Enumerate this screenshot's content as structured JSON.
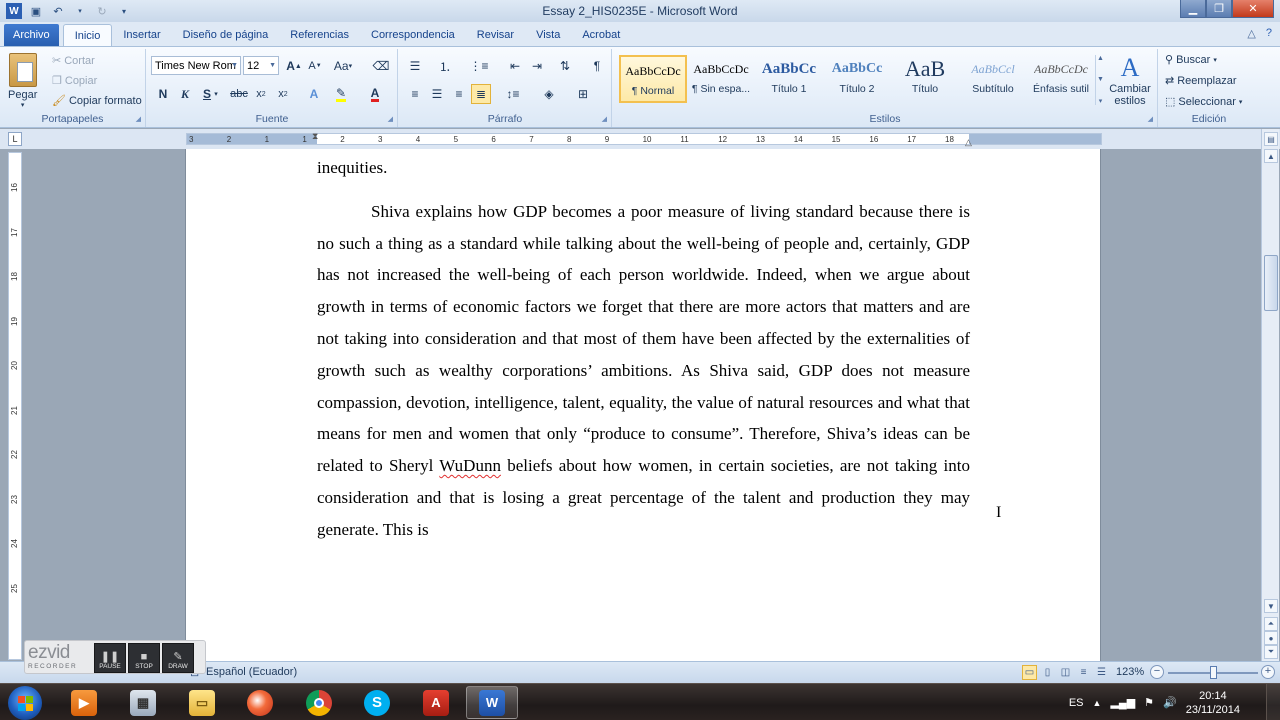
{
  "window": {
    "title": "Essay 2_HIS0235E  -  Microsoft Word"
  },
  "tabs": [
    {
      "label": "Archivo"
    },
    {
      "label": "Inicio"
    },
    {
      "label": "Insertar"
    },
    {
      "label": "Diseño de página"
    },
    {
      "label": "Referencias"
    },
    {
      "label": "Correspondencia"
    },
    {
      "label": "Revisar"
    },
    {
      "label": "Vista"
    },
    {
      "label": "Acrobat"
    }
  ],
  "ribbon": {
    "clipboard": {
      "label": "Portapapeles",
      "paste": "Pegar",
      "cut": "Cortar",
      "copy": "Copiar",
      "format_painter": "Copiar formato"
    },
    "font": {
      "label": "Fuente",
      "font_name": "Times New Rom",
      "font_size": "12",
      "bold": "N",
      "italic": "K",
      "underline": "S"
    },
    "paragraph": {
      "label": "Párrafo"
    },
    "styles": {
      "label": "Estilos",
      "items": [
        {
          "sample": "AaBbCcDc",
          "name": "¶ Normal"
        },
        {
          "sample": "AaBbCcDc",
          "name": "¶ Sin espa..."
        },
        {
          "sample": "AaBbCc",
          "name": "Título 1"
        },
        {
          "sample": "AaBbCc",
          "name": "Título 2"
        },
        {
          "sample": "AaB",
          "name": "Título"
        },
        {
          "sample": "AaBbCcl",
          "name": "Subtítulo"
        },
        {
          "sample": "AaBbCcDc",
          "name": "Énfasis sutil"
        }
      ],
      "change_styles": "Cambiar estilos"
    },
    "editing": {
      "label": "Edición",
      "find": "Buscar",
      "replace": "Reemplazar",
      "select": "Seleccionar"
    }
  },
  "ruler": {
    "h_ticks": [
      "3",
      "2",
      "1",
      "1",
      "2",
      "3",
      "4",
      "5",
      "6",
      "7",
      "8",
      "9",
      "10",
      "11",
      "12",
      "13",
      "14",
      "15",
      "16",
      "17",
      "18"
    ],
    "v_ticks": [
      "16",
      "17",
      "18",
      "19",
      "20",
      "21",
      "22",
      "23",
      "24",
      "25"
    ]
  },
  "document": {
    "line0": "inequities.",
    "para_before": "Shiva explains how GDP becomes a poor measure of living standard because there is no such a thing as a standard while talking about the well-being of people and, certainly, GDP has not increased the well-being of each person worldwide. Indeed, when we argue about growth in terms of economic factors we forget that there are more actors that matters and are not taking into consideration and that most of them have been affected by the externalities of growth such as wealthy corporations’ ambitions. As Shiva said, GDP does not measure compassion, devotion, intelligence, talent, equality, the value of natural resources and what that means for men and women that only “produce to consume”. Therefore, Shiva’s ideas can be related to Sheryl ",
    "misspelled": "WuDunn",
    "para_after": " beliefs about how women, in certain societies, are not taking into consideration and that is losing a great percentage of the talent and production they may generate. This is"
  },
  "statusbar": {
    "language": "Español (Ecuador)",
    "zoom": "123%",
    "zoom_minus": "−",
    "zoom_plus": "+"
  },
  "recorder": {
    "logo": "ezvid",
    "sub": "RECORDER",
    "pause": "PAUSE",
    "stop": "STOP",
    "draw": "DRAW"
  },
  "taskbar": {
    "tray_lang": "ES",
    "time": "20:14",
    "date": "23/11/2014"
  }
}
